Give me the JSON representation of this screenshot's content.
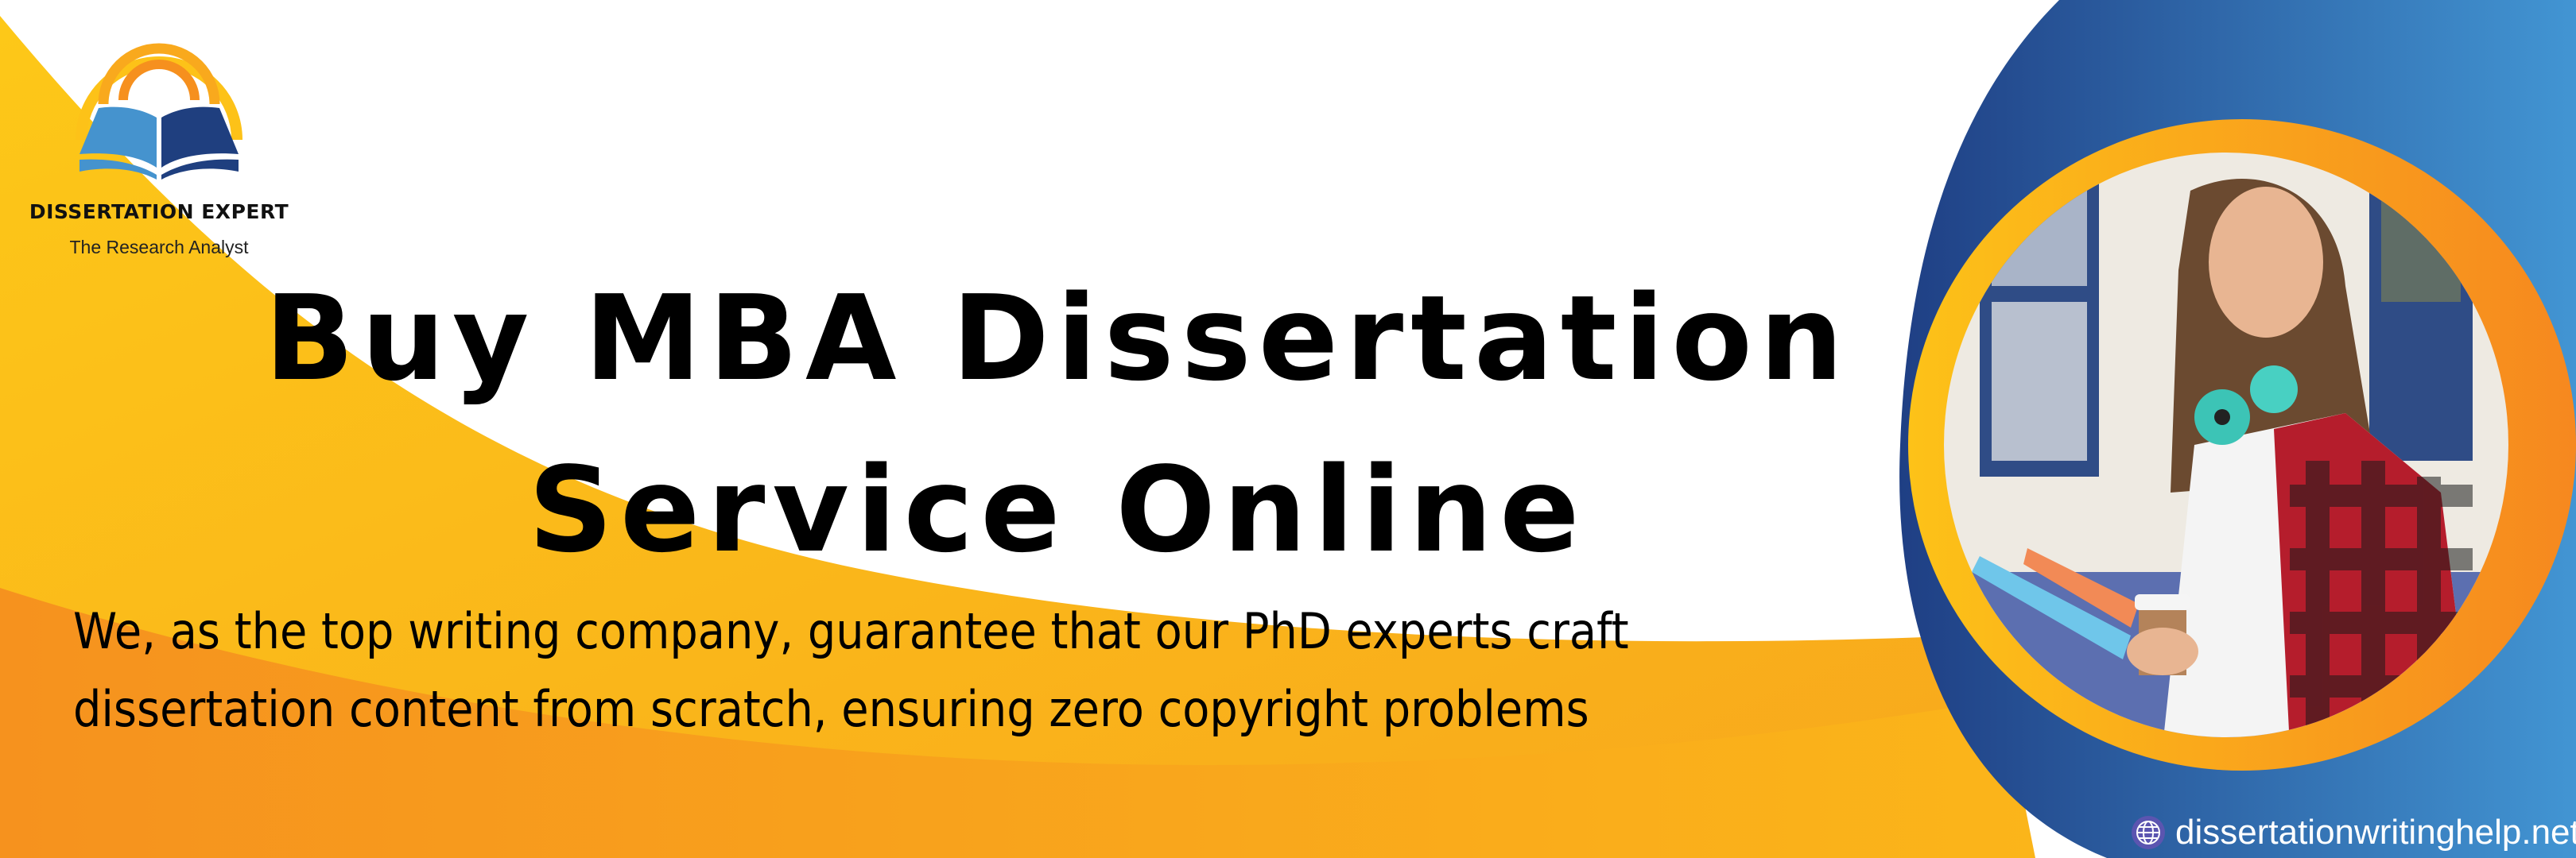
{
  "logo": {
    "name": "DISSERTATION EXPERT",
    "tagline": "The Research Analyst"
  },
  "headline": {
    "line1": "Buy MBA Dissertation",
    "line2": "Service Online"
  },
  "subheadline": {
    "line1": "We, as the top writing company, guarantee that our PhD experts craft",
    "line2": "dissertation content from scratch, ensuring zero copyright problems"
  },
  "website": {
    "icon": "globe-icon",
    "url": "dissertationwritinghelp.net"
  },
  "colors": {
    "yellow": "#FDC218",
    "orange": "#F7901E",
    "blue_dark": "#1F4286",
    "blue_light": "#3F90CF"
  }
}
